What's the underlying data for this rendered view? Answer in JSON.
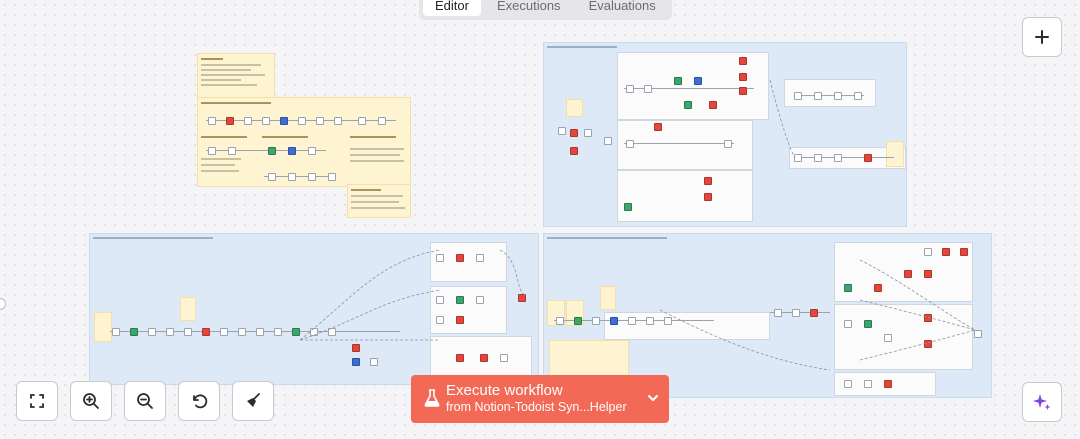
{
  "tabs": [
    {
      "label": "Editor",
      "active": true
    },
    {
      "label": "Executions",
      "active": false
    },
    {
      "label": "Evaluations",
      "active": false
    }
  ],
  "toolbar": {
    "add_node_icon": "plus-icon",
    "zoom_fit_icon": "fit-to-view-icon",
    "zoom_in_icon": "zoom-in-icon",
    "zoom_out_icon": "zoom-out-icon",
    "reset_zoom_icon": "undo-icon",
    "tidy_up_icon": "broom-icon",
    "ai_assistant_icon": "sparkle-icon"
  },
  "execute": {
    "label": "Execute workflow",
    "source": "from Notion-Todoist Syn...Helper",
    "icon": "flask-icon",
    "menu_icon": "chevron-down-icon"
  },
  "colors": {
    "accent": "#f26a55",
    "sticky": "#fff4d1",
    "group": "#dde9f6",
    "ai": "#7b47e6"
  }
}
